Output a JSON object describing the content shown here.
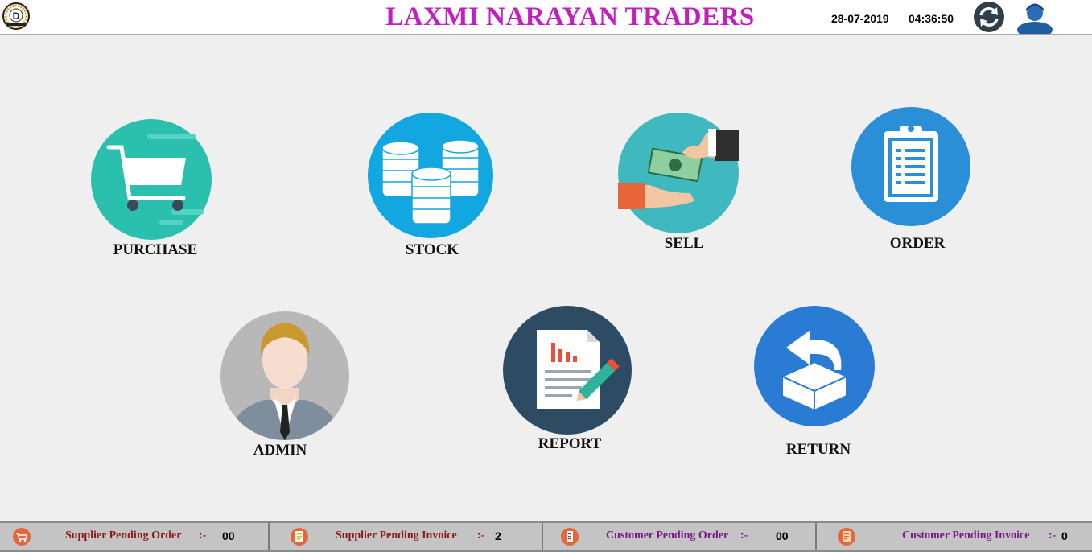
{
  "header": {
    "logo_letter": "D",
    "title": "LAXMI NARAYAN TRADERS",
    "date": "28-07-2019",
    "time": "04:36:50",
    "refresh_icon": "refresh-icon",
    "user_icon": "user-icon"
  },
  "tiles": [
    {
      "label": "PURCHASE",
      "icon": "shopping-cart-icon"
    },
    {
      "label": "STOCK",
      "icon": "stacked-coins-icon"
    },
    {
      "label": "SELL",
      "icon": "cash-handover-icon"
    },
    {
      "label": "ORDER",
      "icon": "clipboard-icon"
    },
    {
      "label": "ADMIN",
      "icon": "admin-person-icon"
    },
    {
      "label": "REPORT",
      "icon": "report-document-icon"
    },
    {
      "label": "RETURN",
      "icon": "return-box-icon"
    }
  ],
  "footer": [
    {
      "label": "Supplier Pending Order",
      "sep": ":-",
      "value": "00",
      "color": "#8b1a1a",
      "icon": "cart-icon"
    },
    {
      "label": "Supplier Pending Invoice",
      "sep": ":-",
      "value": "2",
      "color": "#8b1a1a",
      "icon": "invoice-icon"
    },
    {
      "label": "Customer Pending Order",
      "sep": ":-",
      "value": "00",
      "color": "#7a1a8a",
      "icon": "receipt-icon"
    },
    {
      "label": "Customer Pending Invoice",
      "sep": ":-",
      "value": "0",
      "color": "#7a1a8a",
      "icon": "document-icon"
    }
  ]
}
